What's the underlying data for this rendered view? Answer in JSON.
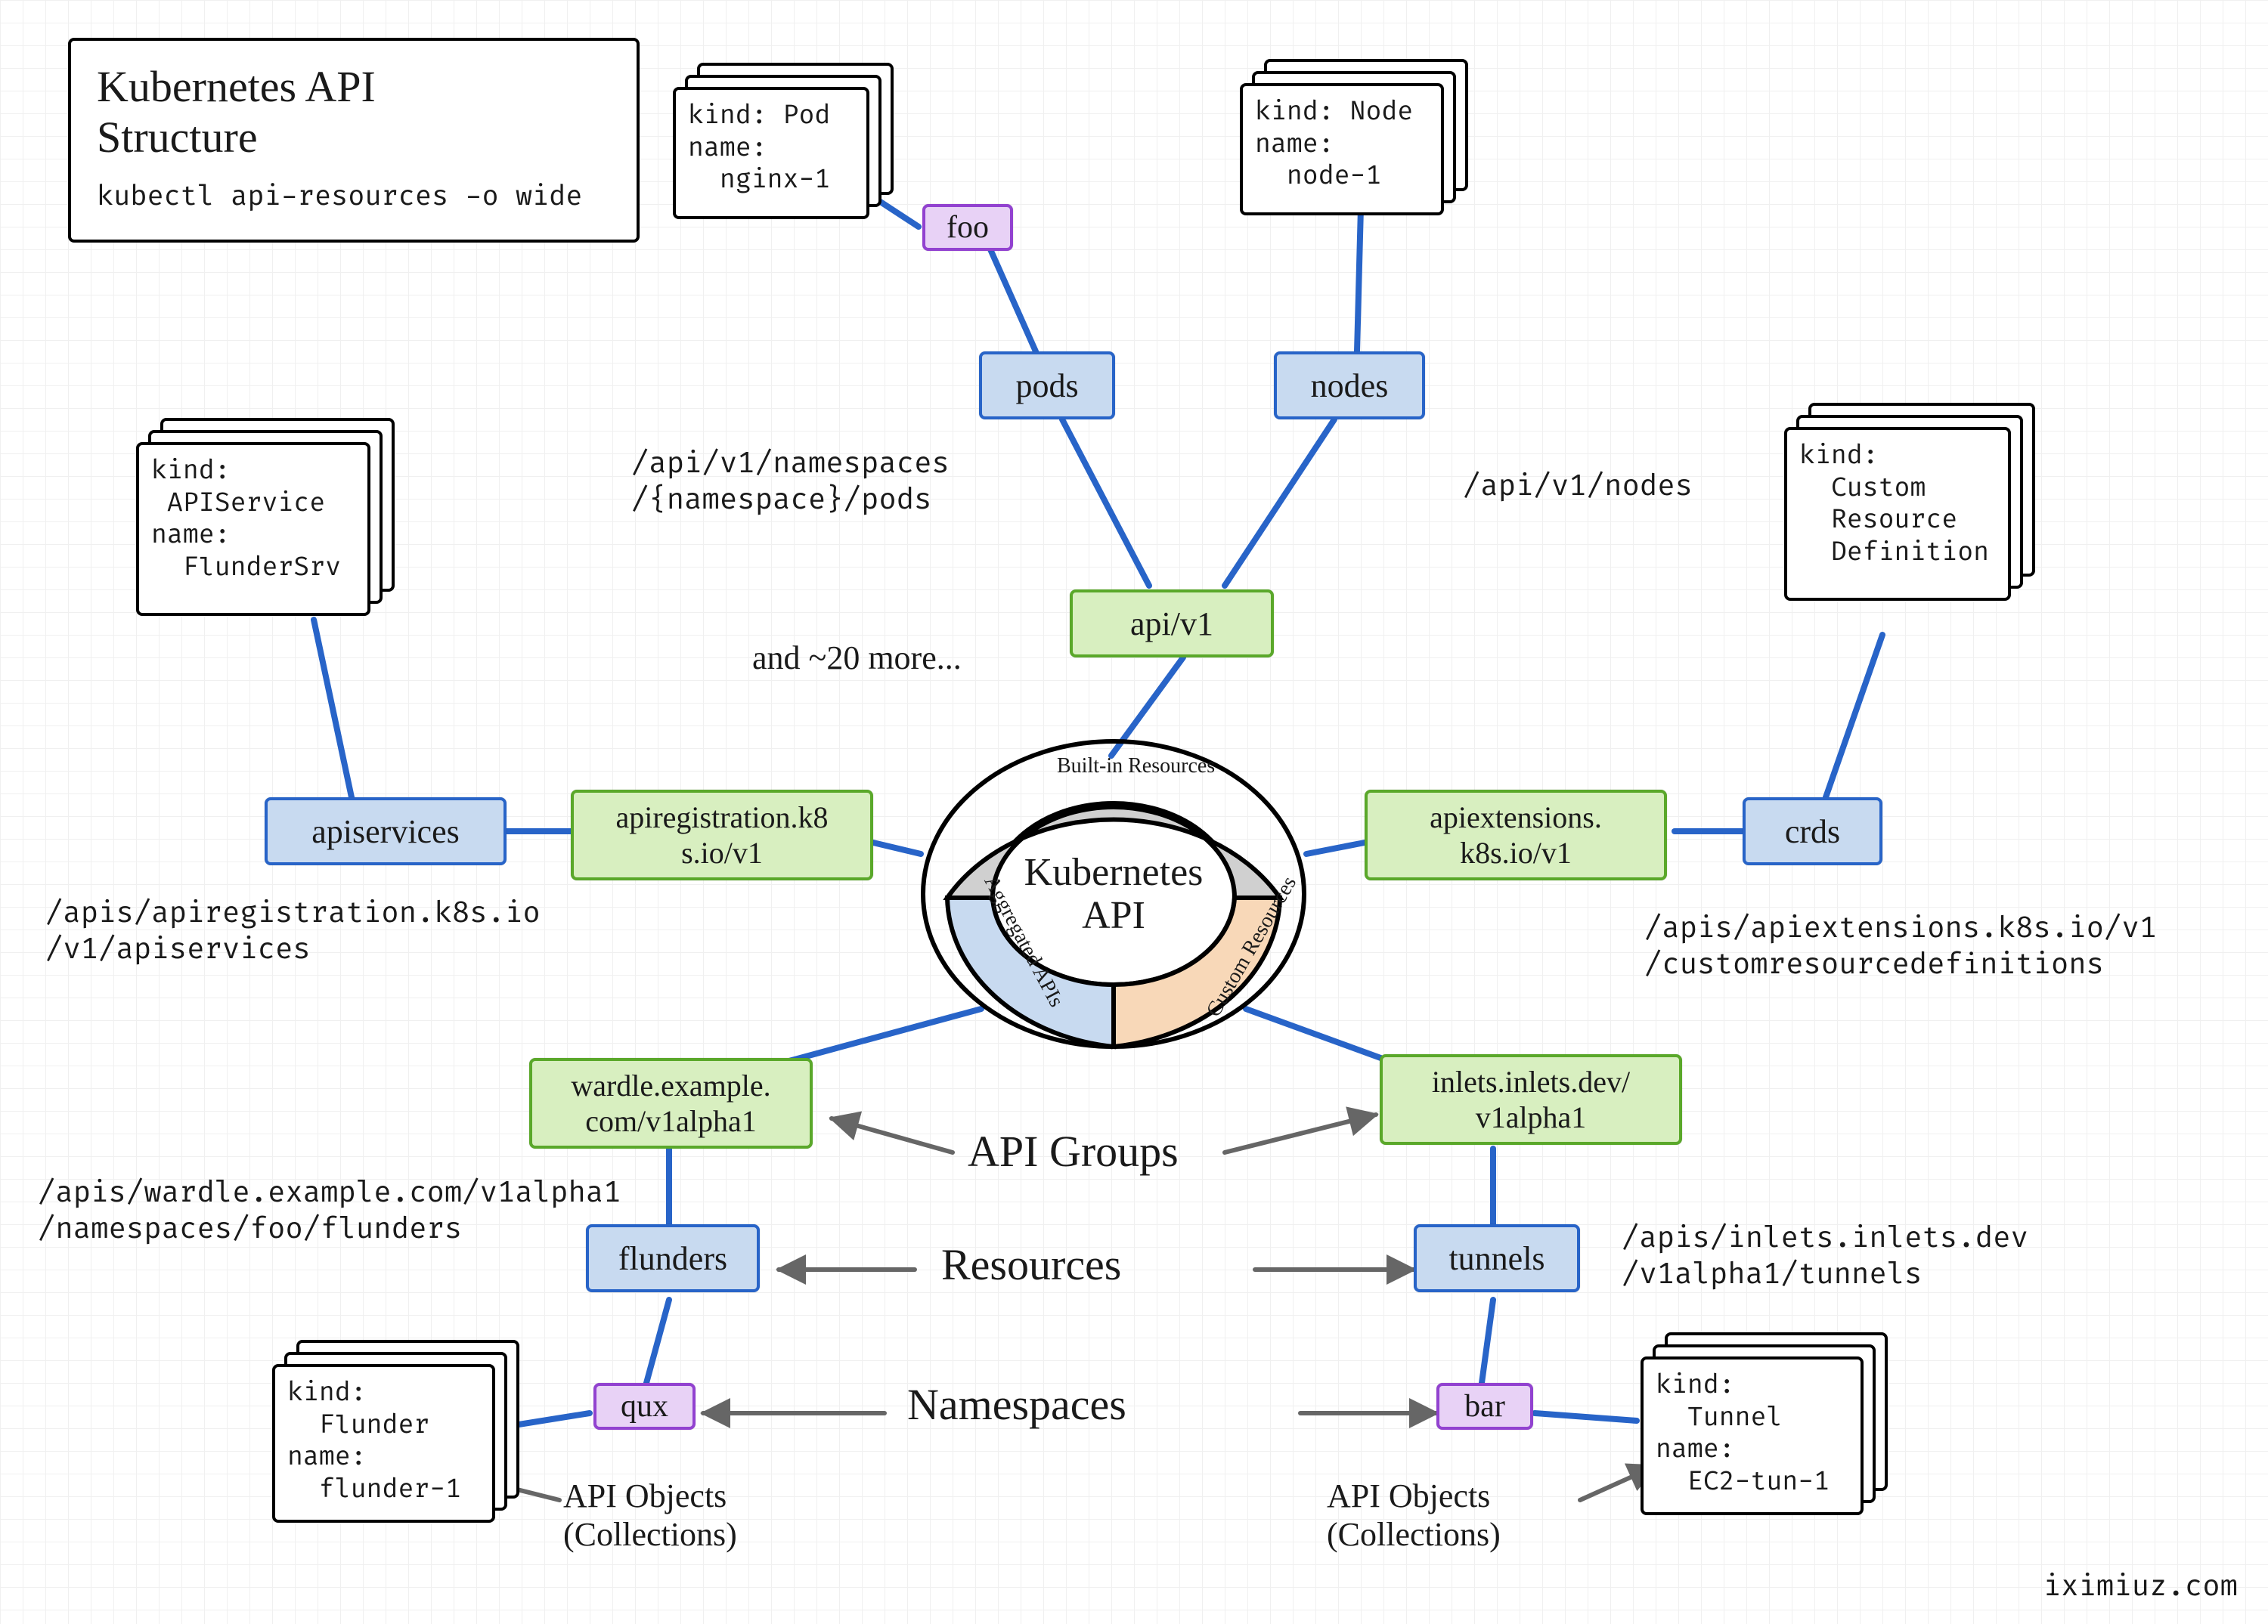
{
  "title": {
    "heading_l1": "Kubernetes API",
    "heading_l2": "Structure",
    "command": "kubectl api-resources -o wide"
  },
  "center": {
    "label_l1": "Kubernetes",
    "label_l2": "API",
    "seg_builtin": "Built-in\nResources",
    "seg_custom": "Custom\nResources",
    "seg_aggregated": "Aggregated\nAPIs"
  },
  "groups": {
    "core": "api/v1",
    "apireg": "apiregistration.k8\ns.io/v1",
    "apiext": "apiextensions.\nk8s.io/v1",
    "wardle": "wardle.example.\ncom/v1alpha1",
    "inlets": "inlets.inlets.dev/\nv1alpha1"
  },
  "resources": {
    "pods": "pods",
    "nodes": "nodes",
    "apisvcs": "apiservices",
    "crds": "crds",
    "flunders": "flunders",
    "tunnels": "tunnels"
  },
  "namespaces": {
    "foo": "foo",
    "qux": "qux",
    "bar": "bar"
  },
  "yaml": {
    "pod": "kind: Pod\nname:\n  nginx-1",
    "node": "kind: Node\nname:\n  node-1",
    "apisvc": "kind:\n APIService\nname:\n  FlunderSrv",
    "crd": "kind:\n  Custom\n  Resource\n  Definition",
    "flunder": "kind:\n  Flunder\nname:\n  flunder-1",
    "tunnel": "kind:\n  Tunnel\nname:\n  EC2-tun-1"
  },
  "paths": {
    "pods": "/api/v1/namespaces\n/{namespace}/pods",
    "nodes": "/api/v1/nodes",
    "apisvc": "/apis/apiregistration.k8s.io\n/v1/apiservices",
    "crds": "/apis/apiextensions.k8s.io/v1\n/customresourcedefinitions",
    "wardle": "/apis/wardle.example.com/v1alpha1\n/namespaces/foo/flunders",
    "inlets": "/apis/inlets.inlets.dev\n/v1alpha1/tunnels"
  },
  "annotations": {
    "more": "and ~20 more...",
    "api_groups": "API Groups",
    "resources": "Resources",
    "namespaces": "Namespaces",
    "api_objs_l": "API Objects\n(Collections)",
    "api_objs_r": "API Objects\n(Collections)"
  },
  "attribution": "iximiuz.com"
}
